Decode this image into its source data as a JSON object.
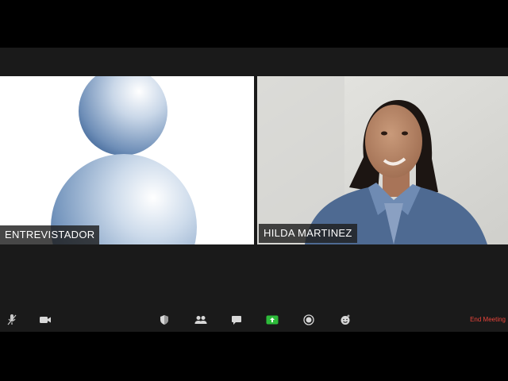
{
  "participants": [
    {
      "name": "ENTREVISTADOR",
      "video": "avatar-placeholder"
    },
    {
      "name": "HILDA MARTINEZ",
      "video": "camera-feed",
      "active_speaker": true
    }
  ],
  "toolbar": {
    "buttons": [
      {
        "icon": "microphone-icon"
      },
      {
        "icon": "video-camera-icon"
      },
      {
        "icon": "security-shield-icon"
      },
      {
        "icon": "participants-icon"
      },
      {
        "icon": "chat-icon"
      },
      {
        "icon": "share-screen-icon"
      },
      {
        "icon": "record-icon"
      },
      {
        "icon": "reactions-icon"
      }
    ],
    "end_label": "End Meeting"
  },
  "colors": {
    "share_accent": "#2dbb3a",
    "end_meeting": "#e8443a",
    "active_border": "#7ac943",
    "avatar_blue": "#4f77a8"
  }
}
